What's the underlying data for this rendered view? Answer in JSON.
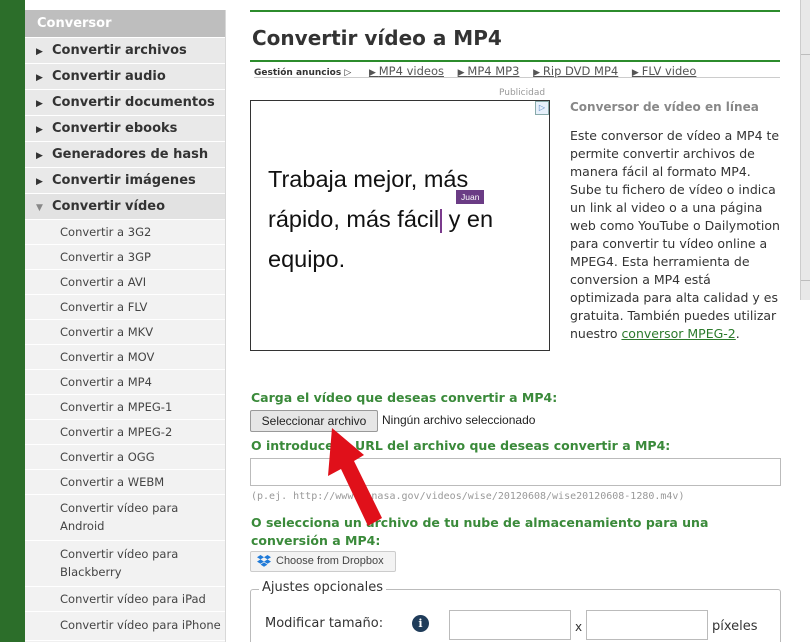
{
  "sidebar": {
    "header": "Conversor",
    "categories": [
      {
        "label": "Convertir archivos",
        "open": false
      },
      {
        "label": "Convertir audio",
        "open": false
      },
      {
        "label": "Convertir documentos",
        "open": false
      },
      {
        "label": "Convertir ebooks",
        "open": false
      },
      {
        "label": "Generadores de hash",
        "open": false
      },
      {
        "label": "Convertir imágenes",
        "open": false
      },
      {
        "label": "Convertir vídeo",
        "open": true
      }
    ],
    "video_items": [
      "Convertir a 3G2",
      "Convertir a 3GP",
      "Convertir a AVI",
      "Convertir a FLV",
      "Convertir a MKV",
      "Convertir a MOV",
      "Convertir a MP4",
      "Convertir a MPEG-1",
      "Convertir a MPEG-2",
      "Convertir a OGG",
      "Convertir a WEBM",
      "Convertir vídeo para Android",
      "Convertir vídeo para Blackberry",
      "Convertir vídeo para iPad",
      "Convertir vídeo para iPhone"
    ]
  },
  "main": {
    "title": "Convertir vídeo a MP4",
    "ad_bar": {
      "gestion": "Gestión anuncios",
      "links": [
        "MP4 videos",
        "MP4 MP3",
        "Rip DVD MP4",
        "FLV video"
      ]
    },
    "ad": {
      "publicidad": "Publicidad",
      "text_a": "Trabaja mejor, más rápido, más fácil",
      "text_b": " y en equipo.",
      "tag": "Juan"
    },
    "description": {
      "title": "Conversor de vídeo en línea",
      "body": "Este conversor de vídeo a MP4 te permite convertir archivos de manera fácil al formato MP4. Sube tu fichero de vídeo o indica un link al video o a una página web como YouTube o Dailymotion para convertir tu vídeo online a MPEG4. Esta herramienta de conversion a MP4 está optimizada para alta calidad y es gratuita. También puedes utilizar nuestro ",
      "link": "conversor MPEG-2",
      "end": "."
    },
    "upload": {
      "label": "Carga el vídeo que deseas convertir a MP4:",
      "button": "Seleccionar archivo",
      "status": "Ningún archivo seleccionado"
    },
    "url": {
      "label": "O introduce la URL del archivo que deseas convertir a MP4:",
      "example": "(p.ej. http://www.jpnasa.gov/videos/wise/20120608/wise20120608-1280.m4v)"
    },
    "cloud": {
      "label": "O selecciona un archivo de tu nube de almacenamiento para una conversión a MP4:",
      "dropbox": "Choose from Dropbox"
    },
    "options": {
      "legend": "Ajustes opcionales",
      "size_label": "Modificar tamaño:",
      "info_icon": "i",
      "x": "x",
      "unit": "píxeles"
    }
  },
  "colors": {
    "brand_green": "#2c6e2a",
    "label_green": "#3a8a3a",
    "annotation_red": "#e0101a"
  }
}
